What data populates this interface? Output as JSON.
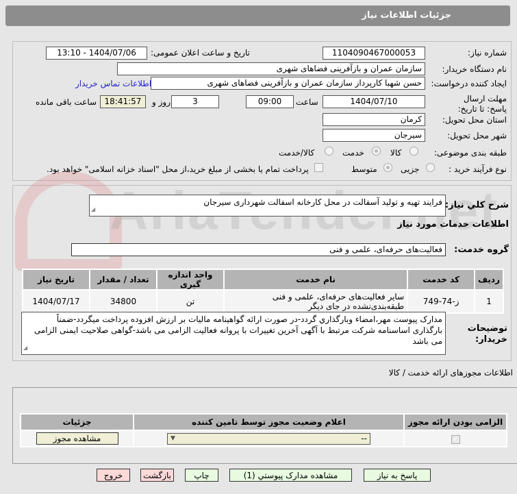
{
  "header": {
    "title": "جزئیات اطلاعات نیاز"
  },
  "watermark": "AriaTender.net",
  "form": {
    "need_number_label": "شماره نیاز:",
    "need_number": "1104090467000053",
    "announce_label": "تاریخ و ساعت اعلان عمومی:",
    "announce_value": "1404/07/06 - 13:10",
    "buyer_label": "نام دستگاه خریدار:",
    "buyer_value": "سازمان عمران و بازآفرینی فضاهای شهری",
    "creator_label": "ایجاد کننده درخواست:",
    "creator_value": "حسن شهبا کارپرداز سازمان عمران و بازآفرینی فضاهای شهری",
    "contact_link": "اطلاعات تماس خریدار",
    "deadline_label": "مهلت ارسال پاسخ: تا تاریخ:",
    "deadline_date": "1404/07/10",
    "time_label": "ساعت",
    "deadline_time": "09:00",
    "days": "3",
    "days_label": "روز و",
    "remaining": "18:41:57",
    "remaining_label": "ساعت باقی مانده",
    "province_label": "استان محل تحویل:",
    "province": "کرمان",
    "city_label": "شهر محل تحویل:",
    "city": "سیرجان",
    "category_label": "طبقه بندی موضوعی:",
    "category_options": [
      "کالا",
      "خدمت",
      "کالا/خدمت"
    ],
    "category_selected": "خدمت",
    "process_label": "نوع فرآیند خرید :",
    "process_options": [
      "جزیی",
      "متوسط"
    ],
    "process_selected": "متوسط",
    "payment_note": "پرداخت تمام یا بخشی از مبلغ خرید،از محل \"اسناد خزانه اسلامی\" خواهد بود."
  },
  "details": {
    "summary_label": "شرح کلي نياز:",
    "summary": "فرایند تهیه و تولید آسفالت در محل کارخانه اسفالت شهرداری سیرجان",
    "services_title": "اطلاعات خدمات مورد نیاز",
    "group_label": "گروه خدمت:",
    "group": "فعالیت‌های حرفه‌ای، علمی و فنی",
    "table": {
      "headers": [
        "ردیف",
        "کد خدمت",
        "نام خدمت",
        "واحد اندازه گیری",
        "تعداد / مقدار",
        "تاریخ نیاز"
      ],
      "rows": [
        [
          "1",
          "ز-74-749",
          "سایر فعالیت‌های حرفه‌ای، علمی و فنی طبقه‌بندی‌نشده در جای دیگر",
          "تن",
          "34800",
          "1404/07/17"
        ]
      ]
    },
    "notes_label": "توضیحات خریدار:",
    "notes": "مدارک پیوست مهر،امضاء وبارگذاري گردد-در صورت ارائه گواهینامه مالیات بر ارزش افزوده پرداخت میگردد-ضمناً بارگذاری اساسنامه شرکت مرتبط با آگهی آخرین تغییرات با پروانه فعالیت الزامی می باشد-گواهی صلاحیت ایمنی الزامی می باشد"
  },
  "permits": {
    "title": "اطلاعات مجوزهای ارائه خدمت / کالا",
    "headers": [
      "الزامی بودن ارائه مجوز",
      "اعلام وضعیت مجوز توسط تامین کننده",
      "جزئیات"
    ],
    "select_value": "--",
    "view_button": "مشاهده مجوز"
  },
  "buttons": {
    "reply": "پاسخ به نیاز",
    "attachments": "مشاهده مدارک پیوستي (1)",
    "print": "چاپ",
    "back": "بازگشت",
    "exit": "خروج"
  }
}
